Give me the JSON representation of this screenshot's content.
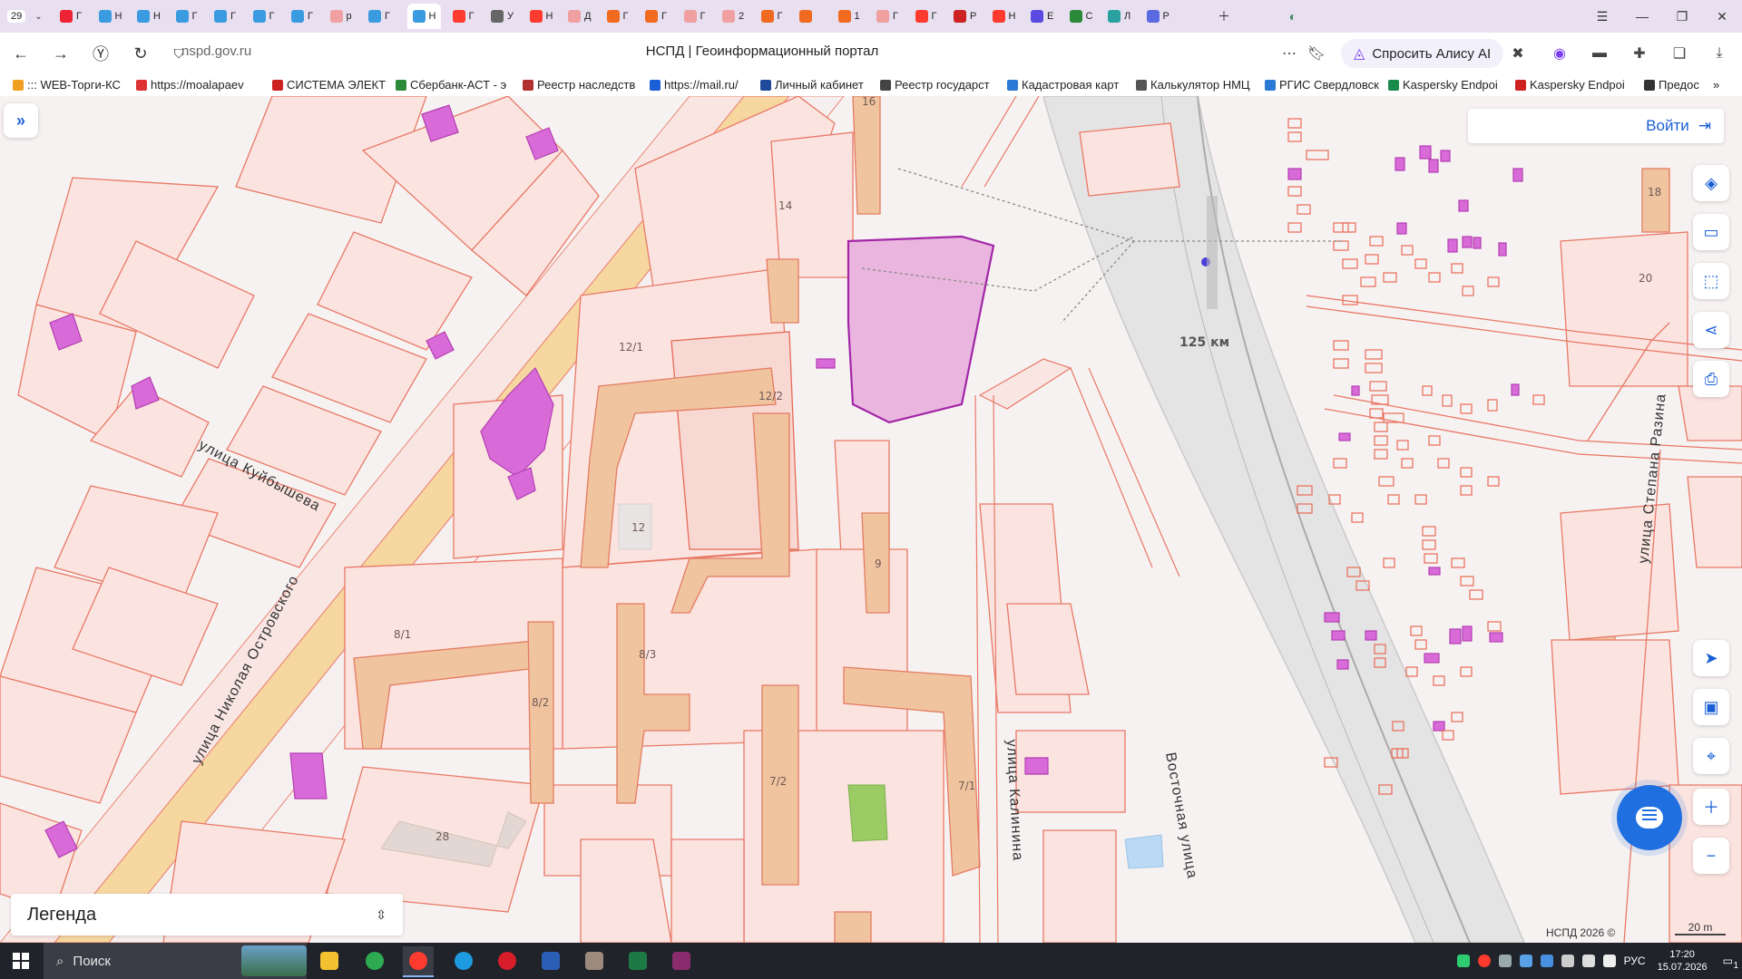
{
  "browser": {
    "tab_counter": "29",
    "tab_labels": [
      "Г",
      "Н",
      "Н",
      "Г",
      "Г",
      "Г",
      "Г",
      "р",
      "Г",
      "Н",
      "Г",
      "У",
      "Н",
      "Д",
      "Г",
      "Г",
      "Г",
      "2",
      "Г",
      "",
      "1",
      "Г",
      "Г",
      "Р",
      "Н",
      "Е",
      "С",
      "Л",
      "Р"
    ],
    "url": "nspd.gov.ru",
    "page_title": "НСПД | Геоинформационный портал",
    "alice_label": "Спросить Алису AI"
  },
  "bookmarks": [
    {
      "label": "::: WEB-Торги-КС",
      "color": "#f0a020"
    },
    {
      "label": "https://moalapaev",
      "color": "#d33"
    },
    {
      "label": "СИСТЕМА ЭЛЕКТ",
      "color": "#c22"
    },
    {
      "label": "Сбербанк-АСТ - э",
      "color": "#2a8a3a"
    },
    {
      "label": "Реестр наследств",
      "color": "#b03030"
    },
    {
      "label": "https://mail.ru/",
      "color": "#1a5fd6"
    },
    {
      "label": "Личный кабинет",
      "color": "#204a9a"
    },
    {
      "label": "Реестр государст",
      "color": "#444"
    },
    {
      "label": "Кадастровая карт",
      "color": "#2a7ad6"
    },
    {
      "label": "Калькулятор НМЦ",
      "color": "#555"
    },
    {
      "label": "РГИС Свердловск",
      "color": "#2a7ad6"
    },
    {
      "label": "Kaspersky Endpoi",
      "color": "#1a8a4a"
    },
    {
      "label": "Kaspersky Endpoi",
      "color": "#c22"
    },
    {
      "label": "Предос",
      "color": "#333"
    }
  ],
  "map": {
    "login_label": "Войти",
    "legend_label": "Легенда",
    "copyright": "НСПД 2026 ©",
    "scale_label": "20 m",
    "km_label": "125 км",
    "street_labels": {
      "kuybysheva": "улица Куйбышева",
      "ostrovskogo": "улица Николая Островского",
      "kalinina": "улица Калинина",
      "vostochnaya": "Восточная улица",
      "razina": "улица Степана Разина"
    },
    "building_numbers": {
      "b16": "16",
      "b14": "14",
      "b12_1": "12/1",
      "b12_2": "12/2",
      "b12": "12",
      "b9": "9",
      "b8_1": "8/1",
      "b8_3": "8/3",
      "b8_2": "8/2",
      "b7_2": "7/2",
      "b7_1": "7/1",
      "b28": "28",
      "b18": "18",
      "b20": "20"
    },
    "tool_icons": [
      "layers-icon",
      "ruler-icon",
      "select-area-icon",
      "share-icon",
      "print-icon",
      "locate-icon",
      "minimap-icon",
      "search-location-icon",
      "zoom-in-icon",
      "zoom-out-icon"
    ]
  },
  "taskbar": {
    "search_label": "Поиск",
    "lang": "РУС",
    "time": "17:20",
    "date": "15.07.2026",
    "notifications": "1"
  }
}
